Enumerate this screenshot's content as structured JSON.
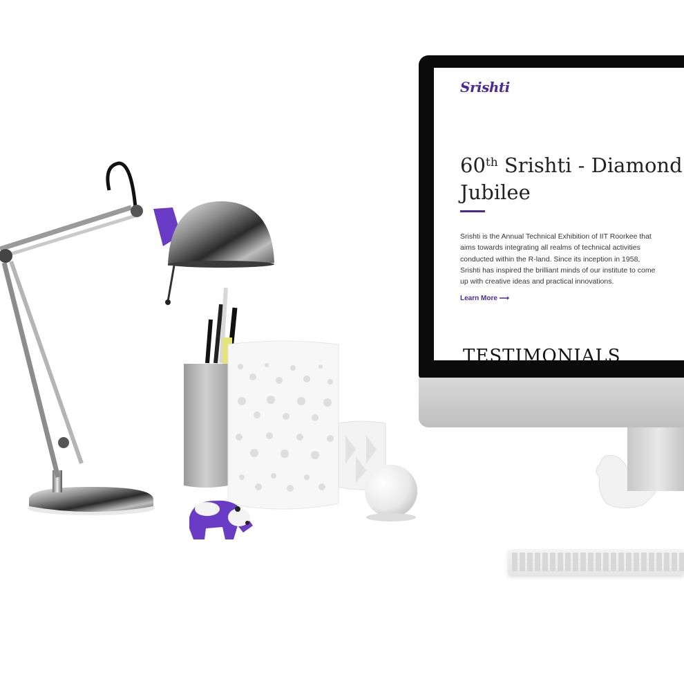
{
  "screen": {
    "logo": "Srishti",
    "hero": {
      "title_number": "60",
      "title_suffix": "th",
      "title_rest": " Srishti - Diamond Jubilee",
      "paragraph": "Srishti is the Annual Technical Exhibition of IIT Roorkee that aims towards integrating all realms of technical activities conducted within the R-land. Since its inception in 1958, Srishti has inspired the brilliant minds of our institute to come up with creative ideas and practical innovations.",
      "learn_more": "Learn More ⟶"
    },
    "section_heading": "TESTIMONIALS"
  },
  "colors": {
    "accent": "#4b2a96",
    "background": "#ffffff",
    "bezel": "#0b0b0b"
  },
  "objects": [
    "desk-lamp",
    "pencil-holder",
    "perforated-vase",
    "small-vase",
    "glass-sphere",
    "panda-figurine",
    "bird-figurine",
    "monitor",
    "keyboard"
  ]
}
